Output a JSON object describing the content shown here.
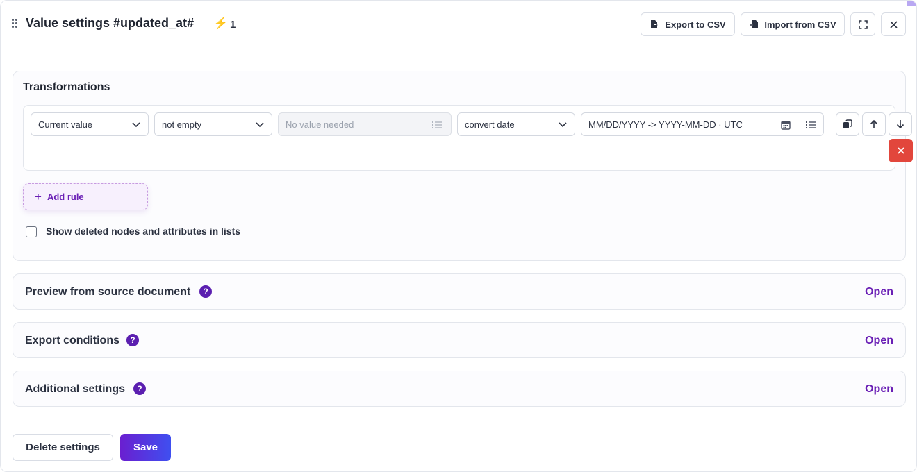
{
  "header": {
    "title": "Value settings #updated_at#",
    "bolt_icon": "lightning-icon",
    "bolt_count": "1",
    "export_label": "Export to CSV",
    "import_label": "Import from CSV",
    "fullscreen_icon": "expand-icon",
    "close_icon": "close-icon"
  },
  "transformations": {
    "title": "Transformations",
    "rule": {
      "source": "Current value",
      "condition": "not empty",
      "value_placeholder": "No value needed",
      "transform": "convert date",
      "format": "MM/DD/YYYY -> YYYY-MM-DD · UTC"
    },
    "add_rule_label": "Add rule",
    "show_deleted_label": "Show deleted nodes and attributes in lists",
    "show_deleted_checked": false
  },
  "sections": {
    "preview": {
      "title": "Preview from source document",
      "action": "Open"
    },
    "export_conditions": {
      "title": "Export conditions",
      "action": "Open"
    },
    "additional": {
      "title": "Additional settings",
      "action": "Open"
    },
    "help_glyph": "?"
  },
  "footer": {
    "delete_label": "Delete settings",
    "save_label": "Save"
  },
  "colors": {
    "accent": "#6a1fb5",
    "danger": "#e2463c",
    "help_badge": "#5b1fb0"
  }
}
